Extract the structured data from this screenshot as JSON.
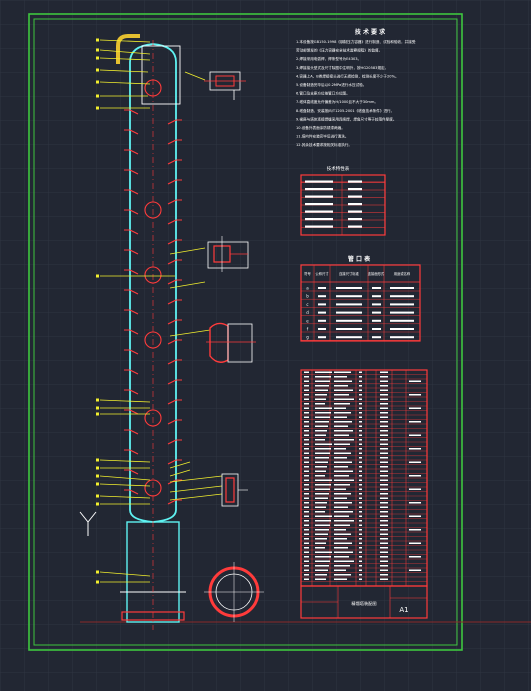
{
  "drawing": {
    "tech_title": "技 术 要 求",
    "tech_lines": [
      "1.本设备按GB150-1998《钢制压力容器》进行制造、试验和验收，并接受",
      "  劳动部颁发的《压力容器安全技术监察规程》的监督。",
      "2.焊接采用电弧焊，焊条型号为E4303。",
      "3.焊接接头型式及尺寸除图中注明外，按HG20583规定。",
      "4.容器上A、B类焊接接头进行无损检测，检测长度不少于20%。",
      "5.设备制造完毕后以0.2MPa进行水压试验。",
      "6.管口及支座方位按管口方位图。",
      "7.塔体直线度允许偏差为H/1000且不大于30mm。",
      "8.塔盘制造、安装按JB/T1205-2001《塔盘技术条件》进行。",
      "9.裙座与塔体连接焊缝采用连续焊，焊角尺寸等于较薄件厚度。",
      "10.设备外表面涂防锈漆两遍。",
      "11.塔内件安装完毕后进行清洗。",
      "12.其余技术要求按相关标准执行。"
    ],
    "spec_title": "技术特性表",
    "nozzle_title": "管 口 表",
    "nozzle_headers": [
      "符号",
      "公称尺寸",
      "连接尺寸标准",
      "连接面形式",
      "用途或名称"
    ],
    "nozzle_symbols": [
      "a",
      "b",
      "c",
      "d",
      "e",
      "f",
      "g"
    ],
    "title_block_name": "精馏塔装配图",
    "sheet_size": "A1"
  },
  "colors": {
    "background": "#222733",
    "grid": "#2f3442",
    "frame": "#3ec63e",
    "vessel": "#5ef2f2",
    "red": "#ff3b3b",
    "leader": "#f2ef2e",
    "text": "#ffffff"
  }
}
